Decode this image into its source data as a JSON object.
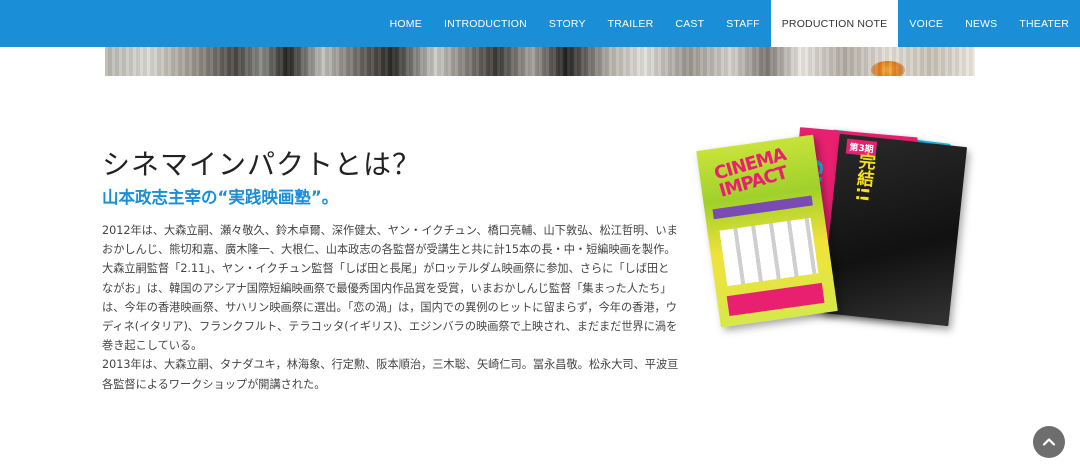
{
  "nav": {
    "items": [
      {
        "label": "HOME",
        "active": false
      },
      {
        "label": "INTRODUCTION",
        "active": false
      },
      {
        "label": "STORY",
        "active": false
      },
      {
        "label": "TRAILER",
        "active": false
      },
      {
        "label": "CAST",
        "active": false
      },
      {
        "label": "STAFF",
        "active": false
      },
      {
        "label": "PRODUCTION NOTE",
        "active": true
      },
      {
        "label": "VOICE",
        "active": false
      },
      {
        "label": "NEWS",
        "active": false
      },
      {
        "label": "THEATER",
        "active": false
      }
    ]
  },
  "section": {
    "title": "シネマインパクトとは？",
    "subtitle": "山本政志主宰の“実践映画塾”。",
    "paragraphs": [
      "2012年は、大森立嗣、瀬々敬久、鈴木卓爾、深作健太、ヤン・イクチュン、橋口亮輔、山下敦弘、松江哲明、いまおかしんじ、熊切和嘉、廣木隆一、大根仁、山本政志の各監督が受講生と共に計15本の長・中・短編映画を製作。大森立嗣監督「2.11」、ヤン・イクチュン監督「しば田と長尾」がロッテルダム映画祭に参加、さらに「しば田とながお」は、韓国のアシアナ国際短編映画祭で最優秀国内作品賞を受賞，いまおかしんじ監督「集まった人たち」は、今年の香港映画祭、サハリン映画祭に選出。「恋の渦」は，国内での異例のヒットに留まらず，今年の香港，ウディネ(イタリア)、フランクフルト、テラコッタ(イギリス)、エジンバラの映画祭で上映され、まだまだ世界に渦を巻き起こしている。",
      "2013年は、大森立嗣、タナダユキ，林海象、行定勲、阪本順治，三木聡、矢崎仁司。冨永昌敬。松永大司、平波亘各監督によるワークショップが開講された。"
    ]
  },
  "posters": {
    "green_title": "CINEMA IMPACT",
    "dark_label": "第3期",
    "dark_title": "完結!!",
    "pink_title": "CINEMA"
  },
  "colors": {
    "nav_bg": "#1a8fd8",
    "accent": "#1a8fd8",
    "to_top_bg": "#6e6e6e"
  },
  "icons": {
    "to_top": "chevron-up-icon"
  }
}
